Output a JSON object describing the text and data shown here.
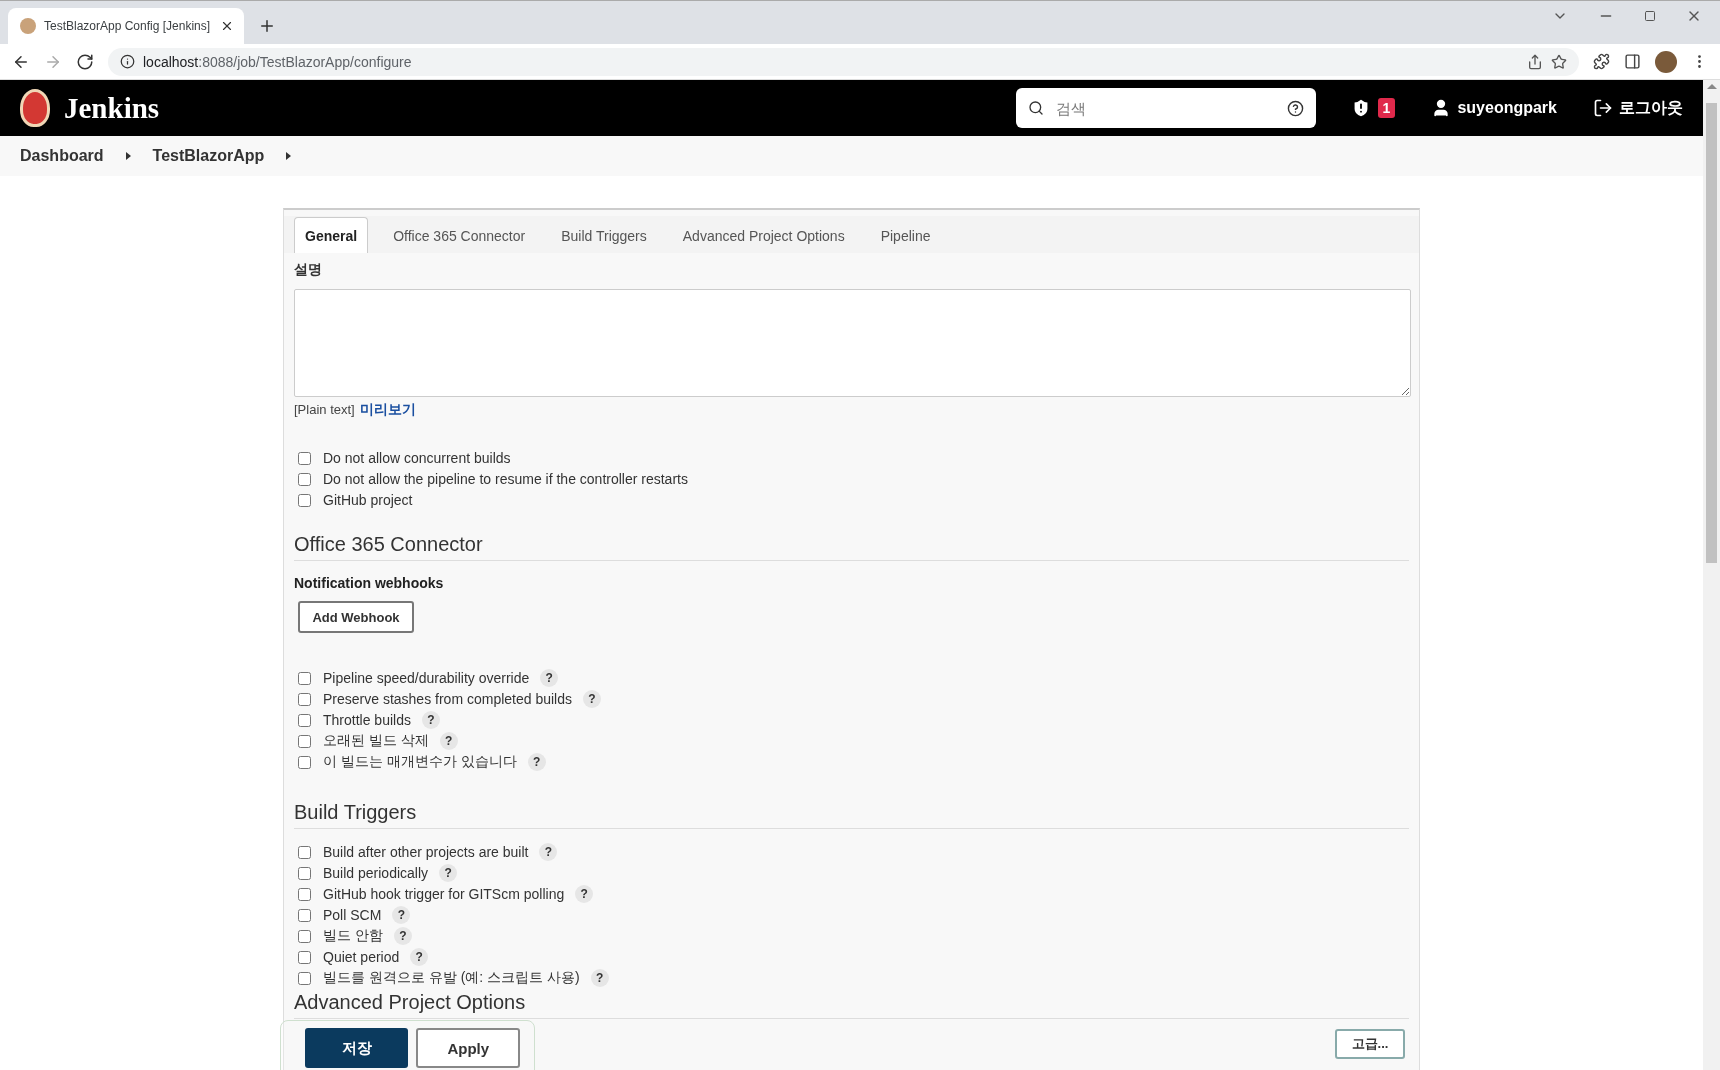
{
  "browser": {
    "tab_title": "TestBlazorApp Config [Jenkins]",
    "url_host": "localhost",
    "url_rest": ":8088/job/TestBlazorApp/configure"
  },
  "header": {
    "brand": "Jenkins",
    "search_placeholder": "검색",
    "alert_count": "1",
    "user": "suyeongpark",
    "logout": "로그아웃"
  },
  "breadcrumbs": [
    "Dashboard",
    "TestBlazorApp"
  ],
  "tabs": [
    {
      "label": "General",
      "selected": true
    },
    {
      "label": "Office 365 Connector",
      "selected": false
    },
    {
      "label": "Build Triggers",
      "selected": false
    },
    {
      "label": "Advanced Project Options",
      "selected": false
    },
    {
      "label": "Pipeline",
      "selected": false
    }
  ],
  "general": {
    "description_label": "설명",
    "format_note": "[Plain text]",
    "preview_link": "미리보기",
    "options": [
      {
        "label": "Do not allow concurrent builds",
        "checked": false
      },
      {
        "label": "Do not allow the pipeline to resume if the controller restarts",
        "checked": false
      },
      {
        "label": "GitHub project",
        "checked": false
      }
    ]
  },
  "office365": {
    "title": "Office 365 Connector",
    "webhooks_label": "Notification webhooks",
    "add_button": "Add Webhook",
    "options": [
      {
        "label": "Pipeline speed/durability override",
        "checked": false,
        "help": "?"
      },
      {
        "label": "Preserve stashes from completed builds",
        "checked": false,
        "help": "?"
      },
      {
        "label": "Throttle builds",
        "checked": false,
        "help": "?"
      },
      {
        "label": "오래된 빌드 삭제",
        "checked": false,
        "help": "?"
      },
      {
        "label": "이 빌드는 매개변수가 있습니다",
        "checked": false,
        "help": "?"
      }
    ]
  },
  "build_triggers": {
    "title": "Build Triggers",
    "options": [
      {
        "label": "Build after other projects are built",
        "checked": false,
        "help": "?"
      },
      {
        "label": "Build periodically",
        "checked": false,
        "help": "?"
      },
      {
        "label": "GitHub hook trigger for GITScm polling",
        "checked": false,
        "help": "?"
      },
      {
        "label": "Poll SCM",
        "checked": false,
        "help": "?"
      },
      {
        "label": "빌드 안함",
        "checked": false,
        "help": "?"
      },
      {
        "label": "Quiet period",
        "checked": false,
        "help": "?"
      },
      {
        "label": "빌드를 원격으로 유발 (예: 스크립트 사용)",
        "checked": false,
        "help": "?"
      }
    ]
  },
  "advanced": {
    "title": "Advanced Project Options",
    "more_button": "고급..."
  },
  "bottom_bar": {
    "save": "저장",
    "apply": "Apply"
  }
}
